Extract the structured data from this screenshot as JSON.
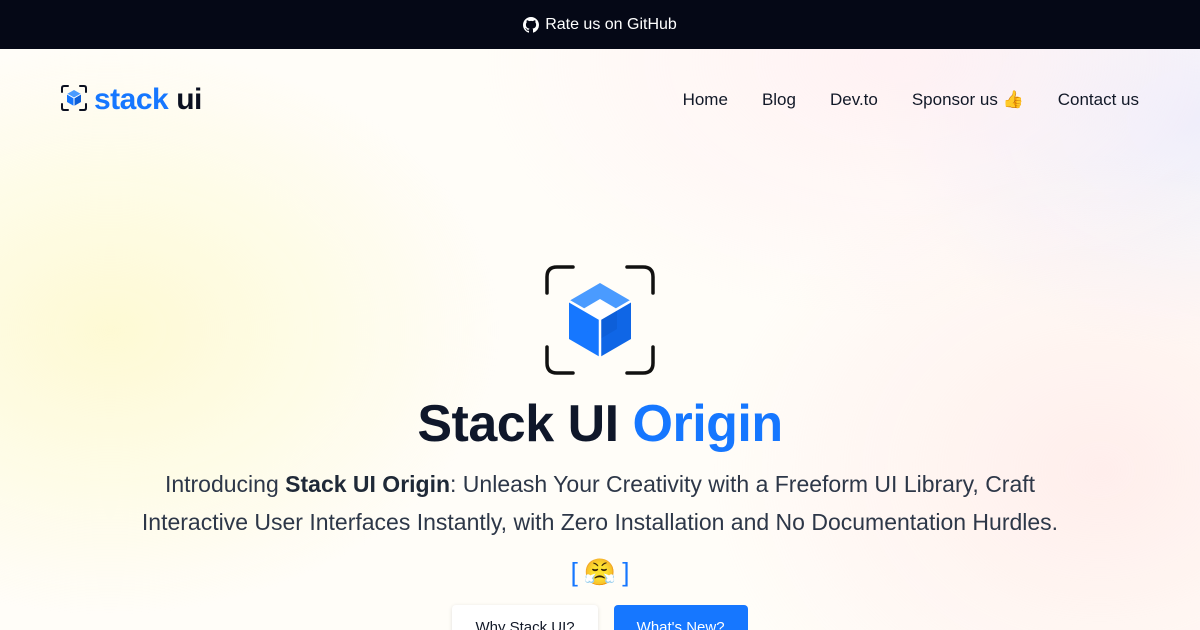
{
  "topbar": {
    "label": "Rate us on GitHub",
    "icon": "github-icon"
  },
  "logo": {
    "part1": "stack",
    "part2": "ui",
    "icon": "cube-icon"
  },
  "nav": {
    "items": [
      {
        "label": "Home"
      },
      {
        "label": "Blog"
      },
      {
        "label": "Dev.to"
      },
      {
        "label": "Sponsor us 👍"
      },
      {
        "label": "Contact us"
      }
    ]
  },
  "hero": {
    "icon": "scan-cube-icon",
    "title_main": "Stack UI",
    "title_accent": "Origin",
    "desc_prefix": "Introducing ",
    "desc_bold": "Stack UI Origin",
    "desc_suffix": ": Unleash Your Creativity with a Freeform UI Library, Craft Interactive User Interfaces Instantly, with Zero Installation and No Documentation Hurdles.",
    "emoji_open": "[",
    "emoji": "😤",
    "emoji_close": "]",
    "buttons": [
      {
        "label": "Why Stack UI?"
      },
      {
        "label": "What's New?"
      }
    ]
  },
  "colors": {
    "accent": "#1677ff",
    "topbar_bg": "#050816"
  }
}
